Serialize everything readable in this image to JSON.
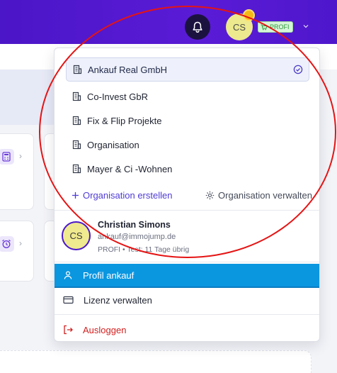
{
  "header": {
    "avatar_initials": "CS",
    "plan_badge": "PROFI",
    "bell_icon": "bell-icon",
    "cart_icon": "cart-icon",
    "chevron_icon": "chevron-down-icon"
  },
  "organizations": {
    "items": [
      {
        "label": "Ankauf Real GmbH",
        "selected": true
      },
      {
        "label": "Co-Invest GbR",
        "selected": false
      },
      {
        "label": "Fix & Flip Projekte",
        "selected": false
      },
      {
        "label": "Organisation",
        "selected": false
      },
      {
        "label": "Mayer & Ci -Wohnen",
        "selected": false
      }
    ],
    "create_label": "Organisation erstellen",
    "manage_label": "Organisation verwalten"
  },
  "user": {
    "initials": "CS",
    "name": "Christian Simons",
    "email": "ankauf@immojump.de",
    "plan": "PROFI • Test: 11 Tage übrig"
  },
  "menu": {
    "profile_label": "Profil ankauf",
    "license_label": "Lizenz verwalten",
    "logout_label": "Ausloggen"
  },
  "colors": {
    "header": "#4b16c7",
    "accent": "#4e3bd6",
    "active_item": "#0b96e0",
    "logout": "#d32020",
    "annotation": "#e51414"
  }
}
